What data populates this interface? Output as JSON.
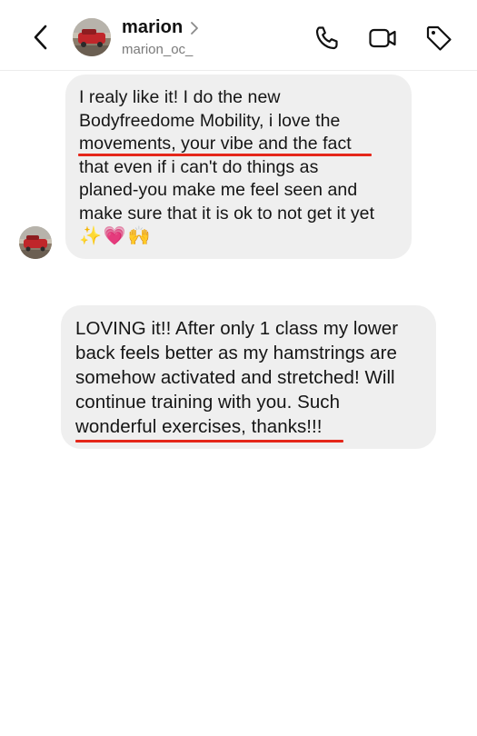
{
  "header": {
    "name": "marion",
    "handle": "marion_oc_",
    "icons": [
      "back-chevron-icon",
      "chevron-right-icon",
      "phone-icon",
      "video-camera-icon",
      "tag-icon"
    ]
  },
  "messages": [
    {
      "lines": [
        "I realy like it! I do the new",
        "Bodyfreedome Mobility, i love the",
        "movements, your vibe and the fact",
        "that even if i can't do things as",
        "planed-you make me feel seen and",
        "make sure that it is ok to not get it yet"
      ],
      "emoji": "✨💗🙌"
    },
    {
      "lines": [
        "LOVING it!! After only 1 class my lower",
        "back feels better as my hamstrings are",
        "somehow activated and stretched! Will",
        "continue training with you. Such",
        "wonderful exercises, thanks!!!"
      ]
    }
  ],
  "colors": {
    "bubble": "#efefef",
    "underline": "#e5271a",
    "handle": "#7a7a7a"
  }
}
